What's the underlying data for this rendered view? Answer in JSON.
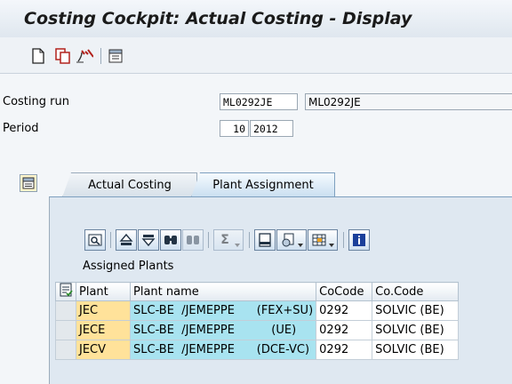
{
  "window": {
    "title": "Costing Cockpit: Actual Costing - Display"
  },
  "toolbar": {
    "buttons": [
      {
        "name": "new-icon"
      },
      {
        "name": "copy-icon"
      },
      {
        "name": "change-icon"
      },
      {
        "name": "layout-icon"
      }
    ]
  },
  "header_fields": {
    "costing_run_label": "Costing run",
    "costing_run_value": "ML0292JE",
    "costing_run_desc": "ML0292JE",
    "period_label": "Period",
    "period_value": "10",
    "year_value": "2012"
  },
  "tabs": [
    {
      "label": "Actual Costing",
      "active": false
    },
    {
      "label": "Plant Assignment",
      "active": true
    }
  ],
  "alv": {
    "title": "Assigned Plants",
    "columns": [
      "Plant",
      "Plant name",
      "CoCode",
      "Co.Code"
    ],
    "rows": [
      {
        "plant": "JEC",
        "name": "SLC-BE  /JEMEPPE      (FEX+SU)",
        "cocode": "0292",
        "coname": "SOLVIC (BE)"
      },
      {
        "plant": "JECE",
        "name": "SLC-BE  /JEMEPPE          (UE)",
        "cocode": "0292",
        "coname": "SOLVIC (BE)"
      },
      {
        "plant": "JECV",
        "name": "SLC-BE  /JEMEPPE      (DCE-VC)",
        "cocode": "0292",
        "coname": "SOLVIC (BE)"
      }
    ]
  },
  "colors": {
    "key_cell": "#ffe29a",
    "text_cell": "#a8e3f0",
    "panel": "#dfe8f1"
  }
}
